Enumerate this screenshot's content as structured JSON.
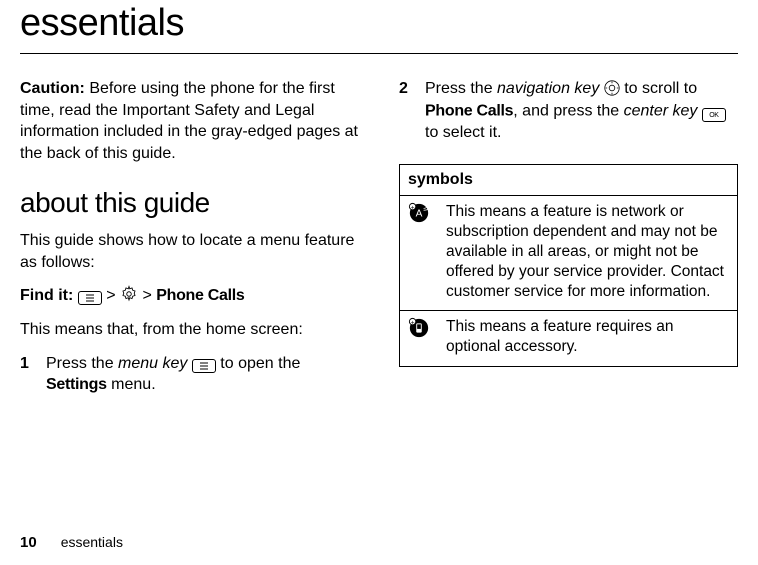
{
  "title": "essentials",
  "left": {
    "caution_label": "Caution:",
    "caution_text": " Before using the phone for the first time, read the Important Safety and Legal information included in the gray-edged pages at the back of this guide.",
    "section_title": "about this guide",
    "intro": "This guide shows how to locate a menu feature as follows:",
    "findit_label": "Find it:",
    "findit_sep1": " > ",
    "findit_sep2": " > ",
    "findit_target": "Phone Calls",
    "means": "This means that, from the home screen:",
    "step1_num": "1",
    "step1_a": "Press the ",
    "step1_key": "menu key",
    "step1_b": " to open the ",
    "step1_menu": "Settings",
    "step1_c": " menu."
  },
  "right": {
    "step2_num": "2",
    "step2_a": "Press the ",
    "step2_key1": "navigation key",
    "step2_b": " to scroll to ",
    "step2_target": "Phone Calls",
    "step2_c": ", and press the ",
    "step2_key2": "center key",
    "step2_d": " to select it.",
    "symbols_header": "symbols",
    "sym1_text": "This means a feature is network or subscription dependent and may not be available in all areas, or might not be offered by your service provider. Contact customer service for more information.",
    "sym2_text": "This means a feature requires an optional accessory."
  },
  "footer": {
    "page": "10",
    "section": "essentials"
  },
  "icons": {
    "menu": "menu-key-icon",
    "settings": "settings-icon",
    "nav": "nav-key-icon",
    "ok": "OK",
    "network": "network-feature-icon",
    "accessory": "optional-accessory-icon"
  }
}
